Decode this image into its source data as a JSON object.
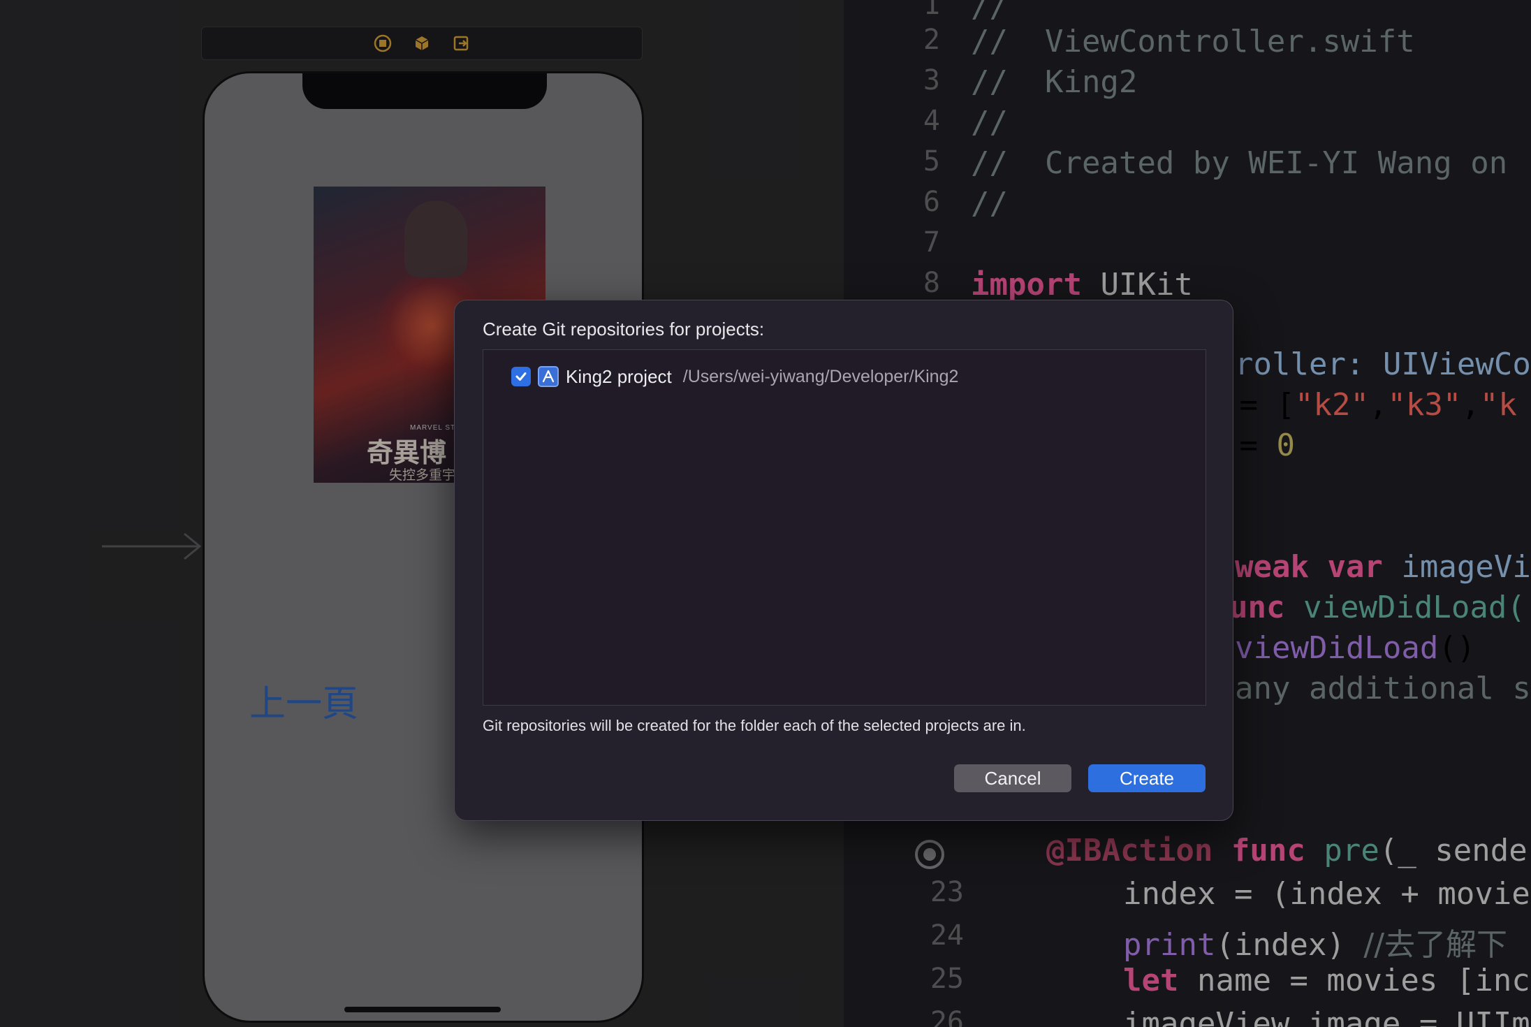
{
  "storyboard": {
    "poster_studio": "MARVEL STUDIOS",
    "poster_title": "奇異博",
    "poster_subtitle": "失控多重宇",
    "prev_button_label": "上一頁"
  },
  "editor": {
    "lines": [
      {
        "num": "1",
        "text": "//"
      },
      {
        "num": "2",
        "text": "//  ViewController.swift"
      },
      {
        "num": "3",
        "text": "//  King2"
      },
      {
        "num": "4",
        "text": "//"
      },
      {
        "num": "5",
        "text": "//  Created by WEI-YI Wang on"
      },
      {
        "num": "6",
        "text": "//"
      },
      {
        "num": "7",
        "text": ""
      },
      {
        "num": "8",
        "kw": "import",
        "rest": " UIKit"
      }
    ],
    "partial": {
      "l10_rest": "roller: ",
      "l10_type": "UIViewCo",
      "l11_a": " = [",
      "l11_s1": "\"k2\"",
      "l11_s2": "\"k3\"",
      "l11_s3": "\"k",
      "l12_a": " = ",
      "l12_num": "0",
      "l15_kw": "weak var",
      "l15_rest": " imageVi",
      "l16_kw": "unc",
      "l16_fn": " viewDidLoad(",
      "l17_fn": "viewDidLoad",
      "l17_rest": "()",
      "l18_cmt": "any additional s"
    },
    "bottom": [
      {
        "num": "",
        "att": "@IBAction",
        "kw": " func",
        "fn": " pre",
        "rest": "(_ sende"
      },
      {
        "num": "23",
        "rest": "index = (index + movie"
      },
      {
        "num": "24",
        "fn": "print",
        "rest": "(index) ",
        "cmt": "//去了解下"
      },
      {
        "num": "25",
        "kw": "let",
        "rest": " name = movies [inc"
      },
      {
        "num": "26",
        "rest": "imageView.image = UIIm"
      }
    ]
  },
  "dialog": {
    "title": "Create Git repositories for projects:",
    "project_name": "King2 project",
    "project_path": "/Users/wei-yiwang/Developer/King2",
    "project_checked": true,
    "note": "Git repositories will be created for the folder each of the selected projects are in.",
    "cancel_label": "Cancel",
    "create_label": "Create"
  }
}
